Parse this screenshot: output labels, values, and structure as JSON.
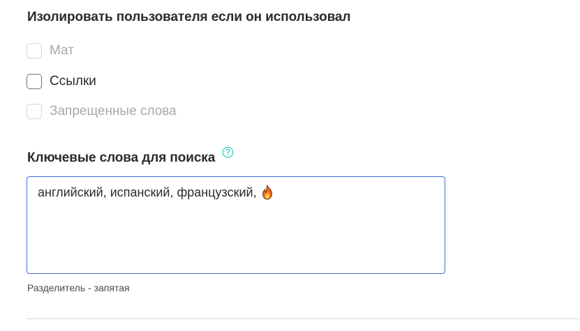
{
  "isolate_section": {
    "title": "Изолировать пользователя если он использовал",
    "options": [
      {
        "label": "Мат",
        "checked": false,
        "disabled": true
      },
      {
        "label": "Ссылки",
        "checked": false,
        "disabled": false
      },
      {
        "label": "Запрещенные слова",
        "checked": false,
        "disabled": true
      }
    ]
  },
  "keywords_section": {
    "title": "Ключевые слова для поиска",
    "help_icon": "question-circle-icon",
    "value": "английский, испанский, французский,",
    "trailing_icon": "fire-emoji-icon",
    "hint": "Разделитель - запятая"
  },
  "colors": {
    "accent_help": "#3ecfc0",
    "input_border": "#3b6fd4",
    "text": "#2b2b2b",
    "disabled_text": "#a9a9a9"
  }
}
